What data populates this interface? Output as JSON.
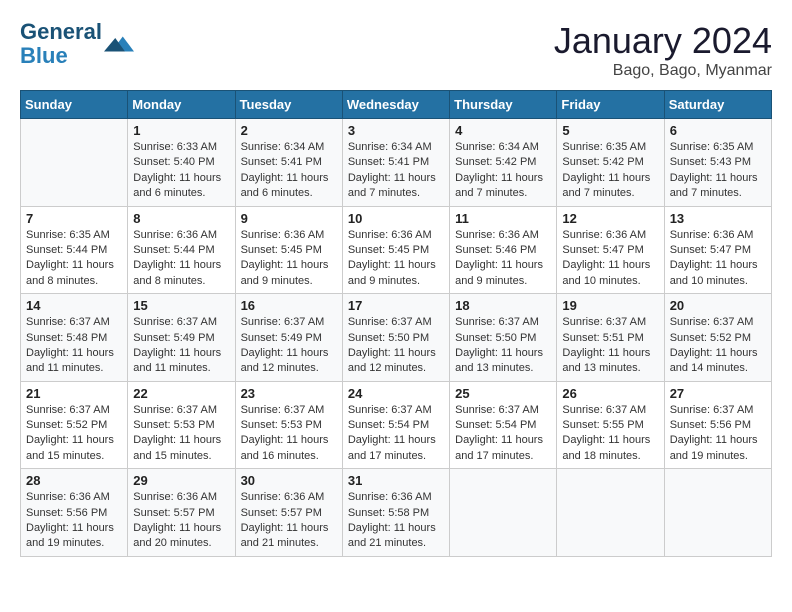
{
  "logo": {
    "line1": "General",
    "line2": "Blue"
  },
  "title": "January 2024",
  "location": "Bago, Bago, Myanmar",
  "days_header": [
    "Sunday",
    "Monday",
    "Tuesday",
    "Wednesday",
    "Thursday",
    "Friday",
    "Saturday"
  ],
  "weeks": [
    [
      {
        "num": "",
        "info": ""
      },
      {
        "num": "1",
        "info": "Sunrise: 6:33 AM\nSunset: 5:40 PM\nDaylight: 11 hours and 6 minutes."
      },
      {
        "num": "2",
        "info": "Sunrise: 6:34 AM\nSunset: 5:41 PM\nDaylight: 11 hours and 6 minutes."
      },
      {
        "num": "3",
        "info": "Sunrise: 6:34 AM\nSunset: 5:41 PM\nDaylight: 11 hours and 7 minutes."
      },
      {
        "num": "4",
        "info": "Sunrise: 6:34 AM\nSunset: 5:42 PM\nDaylight: 11 hours and 7 minutes."
      },
      {
        "num": "5",
        "info": "Sunrise: 6:35 AM\nSunset: 5:42 PM\nDaylight: 11 hours and 7 minutes."
      },
      {
        "num": "6",
        "info": "Sunrise: 6:35 AM\nSunset: 5:43 PM\nDaylight: 11 hours and 7 minutes."
      }
    ],
    [
      {
        "num": "7",
        "info": "Sunrise: 6:35 AM\nSunset: 5:44 PM\nDaylight: 11 hours and 8 minutes."
      },
      {
        "num": "8",
        "info": "Sunrise: 6:36 AM\nSunset: 5:44 PM\nDaylight: 11 hours and 8 minutes."
      },
      {
        "num": "9",
        "info": "Sunrise: 6:36 AM\nSunset: 5:45 PM\nDaylight: 11 hours and 9 minutes."
      },
      {
        "num": "10",
        "info": "Sunrise: 6:36 AM\nSunset: 5:45 PM\nDaylight: 11 hours and 9 minutes."
      },
      {
        "num": "11",
        "info": "Sunrise: 6:36 AM\nSunset: 5:46 PM\nDaylight: 11 hours and 9 minutes."
      },
      {
        "num": "12",
        "info": "Sunrise: 6:36 AM\nSunset: 5:47 PM\nDaylight: 11 hours and 10 minutes."
      },
      {
        "num": "13",
        "info": "Sunrise: 6:36 AM\nSunset: 5:47 PM\nDaylight: 11 hours and 10 minutes."
      }
    ],
    [
      {
        "num": "14",
        "info": "Sunrise: 6:37 AM\nSunset: 5:48 PM\nDaylight: 11 hours and 11 minutes."
      },
      {
        "num": "15",
        "info": "Sunrise: 6:37 AM\nSunset: 5:49 PM\nDaylight: 11 hours and 11 minutes."
      },
      {
        "num": "16",
        "info": "Sunrise: 6:37 AM\nSunset: 5:49 PM\nDaylight: 11 hours and 12 minutes."
      },
      {
        "num": "17",
        "info": "Sunrise: 6:37 AM\nSunset: 5:50 PM\nDaylight: 11 hours and 12 minutes."
      },
      {
        "num": "18",
        "info": "Sunrise: 6:37 AM\nSunset: 5:50 PM\nDaylight: 11 hours and 13 minutes."
      },
      {
        "num": "19",
        "info": "Sunrise: 6:37 AM\nSunset: 5:51 PM\nDaylight: 11 hours and 13 minutes."
      },
      {
        "num": "20",
        "info": "Sunrise: 6:37 AM\nSunset: 5:52 PM\nDaylight: 11 hours and 14 minutes."
      }
    ],
    [
      {
        "num": "21",
        "info": "Sunrise: 6:37 AM\nSunset: 5:52 PM\nDaylight: 11 hours and 15 minutes."
      },
      {
        "num": "22",
        "info": "Sunrise: 6:37 AM\nSunset: 5:53 PM\nDaylight: 11 hours and 15 minutes."
      },
      {
        "num": "23",
        "info": "Sunrise: 6:37 AM\nSunset: 5:53 PM\nDaylight: 11 hours and 16 minutes."
      },
      {
        "num": "24",
        "info": "Sunrise: 6:37 AM\nSunset: 5:54 PM\nDaylight: 11 hours and 17 minutes."
      },
      {
        "num": "25",
        "info": "Sunrise: 6:37 AM\nSunset: 5:54 PM\nDaylight: 11 hours and 17 minutes."
      },
      {
        "num": "26",
        "info": "Sunrise: 6:37 AM\nSunset: 5:55 PM\nDaylight: 11 hours and 18 minutes."
      },
      {
        "num": "27",
        "info": "Sunrise: 6:37 AM\nSunset: 5:56 PM\nDaylight: 11 hours and 19 minutes."
      }
    ],
    [
      {
        "num": "28",
        "info": "Sunrise: 6:36 AM\nSunset: 5:56 PM\nDaylight: 11 hours and 19 minutes."
      },
      {
        "num": "29",
        "info": "Sunrise: 6:36 AM\nSunset: 5:57 PM\nDaylight: 11 hours and 20 minutes."
      },
      {
        "num": "30",
        "info": "Sunrise: 6:36 AM\nSunset: 5:57 PM\nDaylight: 11 hours and 21 minutes."
      },
      {
        "num": "31",
        "info": "Sunrise: 6:36 AM\nSunset: 5:58 PM\nDaylight: 11 hours and 21 minutes."
      },
      {
        "num": "",
        "info": ""
      },
      {
        "num": "",
        "info": ""
      },
      {
        "num": "",
        "info": ""
      }
    ]
  ]
}
